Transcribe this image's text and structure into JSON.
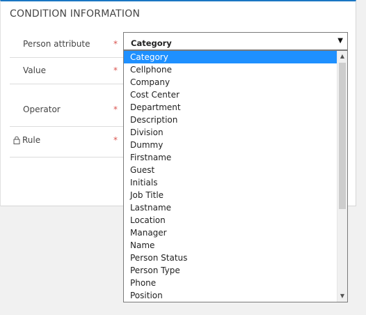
{
  "section": {
    "title": "CONDITION INFORMATION"
  },
  "fields": {
    "person_attribute": {
      "label": "Person attribute",
      "required_mark": "*"
    },
    "value": {
      "label": "Value",
      "required_mark": "*"
    },
    "operator": {
      "label": "Operator",
      "required_mark": "*"
    },
    "rule": {
      "label": "Rule",
      "required_mark": "*",
      "icon": "lock-icon"
    }
  },
  "select": {
    "selected_value": "Category",
    "arrow": "▼",
    "options": [
      "Category",
      "Cellphone",
      "Company",
      "Cost Center",
      "Department",
      "Description",
      "Division",
      "Dummy",
      "Firstname",
      "Guest",
      "Initials",
      "Job Title",
      "Lastname",
      "Location",
      "Manager",
      "Name",
      "Person Status",
      "Person Type",
      "Phone",
      "Position"
    ],
    "highlighted_option": "Category"
  },
  "colors": {
    "accent": "#1a76c3",
    "highlight": "#1e90ff",
    "required": "#d9534f"
  }
}
